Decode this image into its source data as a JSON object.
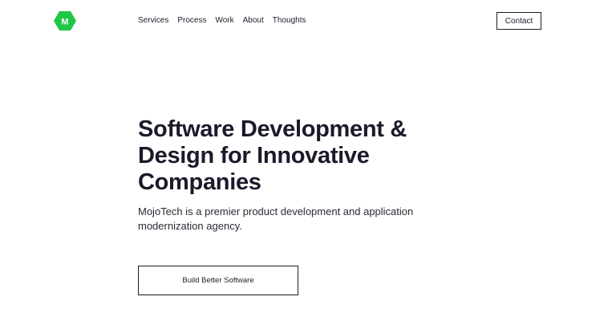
{
  "header": {
    "logo_icon": "mojotech-hexagon-logo",
    "logo_letter": "M",
    "brand_color": "#1fc746",
    "nav": [
      {
        "label": "Services"
      },
      {
        "label": "Process"
      },
      {
        "label": "Work"
      },
      {
        "label": "About"
      },
      {
        "label": "Thoughts"
      }
    ],
    "contact_label": "Contact"
  },
  "hero": {
    "title": "Software Development & Design for Innovative Companies",
    "subtitle": "MojoTech is a premier product development and application modernization agency.",
    "cta_label": "Build Better Software"
  }
}
